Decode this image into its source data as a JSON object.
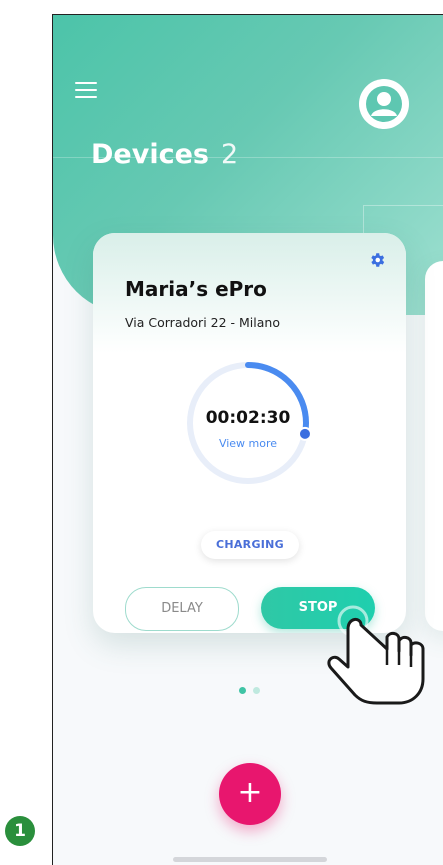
{
  "header": {
    "title": "Devices",
    "count": "2"
  },
  "device_card": {
    "name": "Maria’s ePro",
    "address": "Via Corradori 22 - Milano",
    "timer": "00:02:30",
    "view_more": "View more",
    "status": "CHARGING",
    "delay_label": "DELAY",
    "stop_label": "STOP",
    "progress_fraction": 0.28
  },
  "pagination": {
    "pages": 2,
    "active_index": 0
  },
  "fab": {
    "label": "+"
  },
  "step_badge": "1",
  "colors": {
    "accent": "#4cc4a9",
    "primary_button": "#1fcfae",
    "fab": "#e8166e",
    "progress": "#4a8bf0",
    "status_text": "#4a6fd8"
  },
  "icons": {
    "menu": "menu-icon",
    "avatar": "user-avatar-icon",
    "settings": "gear-icon",
    "pointer": "tap-hand-icon"
  }
}
